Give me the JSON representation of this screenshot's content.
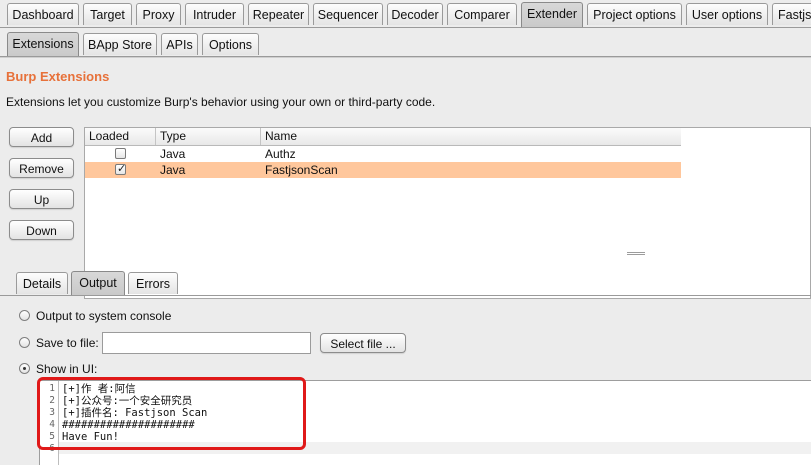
{
  "top_tabs": [
    {
      "label": "Dashboard"
    },
    {
      "label": "Target"
    },
    {
      "label": "Proxy"
    },
    {
      "label": "Intruder"
    },
    {
      "label": "Repeater"
    },
    {
      "label": "Sequencer"
    },
    {
      "label": "Decoder"
    },
    {
      "label": "Comparer"
    },
    {
      "label": "Extender",
      "selected": true
    },
    {
      "label": "Project options"
    },
    {
      "label": "User options"
    },
    {
      "label": "Fastjs"
    }
  ],
  "sub_tabs": [
    {
      "label": "Extensions",
      "selected": true
    },
    {
      "label": "BApp Store"
    },
    {
      "label": "APIs"
    },
    {
      "label": "Options"
    }
  ],
  "extensions_panel": {
    "title": "Burp Extensions",
    "description": "Extensions let you customize Burp's behavior using your own or third-party code.",
    "buttons": {
      "add": "Add",
      "remove": "Remove",
      "up": "Up",
      "down": "Down"
    },
    "table": {
      "columns": [
        "Loaded",
        "Type",
        "Name"
      ],
      "rows": [
        {
          "loaded": false,
          "type": "Java",
          "name": "Authz",
          "selected": false
        },
        {
          "loaded": true,
          "type": "Java",
          "name": "FastjsonScan",
          "selected": true
        }
      ]
    }
  },
  "detail_tabs": [
    {
      "label": "Details"
    },
    {
      "label": "Output",
      "selected": true
    },
    {
      "label": "Errors"
    }
  ],
  "output_options": {
    "system_console_label": "Output to system console",
    "save_to_file_label": "Save to file:",
    "file_path_value": "",
    "select_file_label": "Select file ...",
    "show_in_ui_label": "Show in UI:",
    "selected_option": "show_in_ui"
  },
  "output_console": {
    "line_numbers": [
      "1",
      "2",
      "3",
      "4",
      "5",
      "6"
    ],
    "lines": [
      "[+]作  者:阿信",
      "[+]公众号:一个安全研究员",
      "[+]插件名: Fastjson Scan",
      "#####################",
      "Have Fun!",
      ""
    ]
  },
  "colors": {
    "accent_title": "#e7713a",
    "selected_row": "#ffc79c",
    "annotation_box": "#e01919"
  }
}
